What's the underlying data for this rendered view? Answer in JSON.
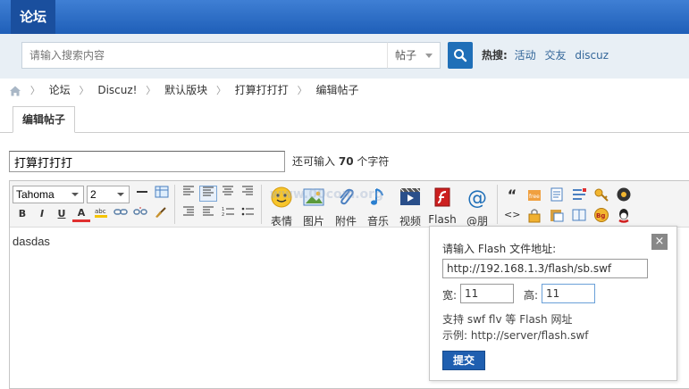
{
  "header": {
    "title": "论坛"
  },
  "search": {
    "placeholder": "请输入搜索内容",
    "type": "帖子",
    "hot_label": "热搜:",
    "hot_links": [
      "活动",
      "交友",
      "discuz"
    ]
  },
  "breadcrumb": [
    "论坛",
    "Discuz!",
    "默认版块",
    "打算打打打",
    "编辑帖子"
  ],
  "tab": {
    "label": "编辑帖子"
  },
  "subject": {
    "value": "打算打打打",
    "remain_prefix": "还可输入",
    "remain_count": "70",
    "remain_suffix": "个字符"
  },
  "toolbar": {
    "font": "Tahoma",
    "size": "2",
    "bold": "B",
    "italic": "I",
    "underline": "U",
    "color": "A",
    "big_buttons": [
      "表情",
      "图片",
      "附件",
      "音乐",
      "视频",
      "Flash",
      "@朋"
    ],
    "quote": "“",
    "code": "<>"
  },
  "editor": {
    "content": "dasdas"
  },
  "watermark": "www.00com.org",
  "flash_dialog": {
    "title": "请输入 Flash 文件地址:",
    "url": "http://192.168.1.3/flash/sb.swf",
    "width_label": "宽:",
    "width_value": "11",
    "height_label": "高:",
    "height_value": "11",
    "tip1": "支持 swf flv 等 Flash 网址",
    "tip2": "示例: http://server/flash.swf",
    "submit": "提交",
    "close": "×"
  },
  "colors": {
    "header_blue": "#2a6cc4",
    "search_bg": "#e8eff5",
    "button_blue": "#1f5fb0",
    "link": "#336699"
  }
}
